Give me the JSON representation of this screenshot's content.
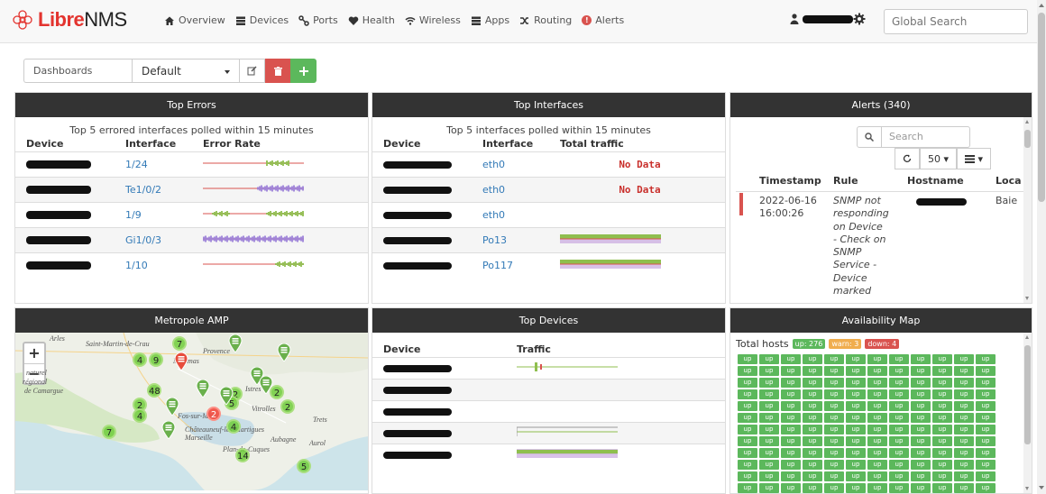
{
  "brand": {
    "part1": "Libre",
    "part2": "NMS"
  },
  "nav": {
    "items": [
      {
        "label": "Overview",
        "icon": "home-icon"
      },
      {
        "label": "Devices",
        "icon": "server-icon"
      },
      {
        "label": "Ports",
        "icon": "link-icon"
      },
      {
        "label": "Health",
        "icon": "heartbeat-icon"
      },
      {
        "label": "Wireless",
        "icon": "wifi-icon"
      },
      {
        "label": "Apps",
        "icon": "tasks-icon"
      },
      {
        "label": "Routing",
        "icon": "random-icon"
      },
      {
        "label": "Alerts",
        "icon": "exclamation-circle-icon"
      }
    ],
    "search_placeholder": "Global Search"
  },
  "dashboard": {
    "label": "Dashboards",
    "selected": "Default"
  },
  "top_errors": {
    "title": "Top Errors",
    "caption": "Top 5 errored interfaces polled within 15 minutes",
    "headers": [
      "Device",
      "Interface",
      "Error Rate"
    ],
    "rows": [
      {
        "interface": "1/24"
      },
      {
        "interface": "Te1/0/2"
      },
      {
        "interface": "1/9"
      },
      {
        "interface": "Gi1/0/3"
      },
      {
        "interface": "1/10"
      }
    ]
  },
  "top_interfaces": {
    "title": "Top Interfaces",
    "caption": "Top 5 interfaces polled within 15 minutes",
    "headers": [
      "Device",
      "Interface",
      "Total traffic"
    ],
    "rows": [
      {
        "interface": "eth0",
        "traffic": "No Data"
      },
      {
        "interface": "eth0",
        "traffic": "No Data"
      },
      {
        "interface": "eth0",
        "traffic": ""
      },
      {
        "interface": "Po13",
        "traffic": ""
      },
      {
        "interface": "Po117",
        "traffic": ""
      }
    ]
  },
  "alerts": {
    "title": "Alerts (340)",
    "search_placeholder": "Search",
    "page_size": "50",
    "headers": [
      "Timestamp",
      "Rule",
      "Hostname",
      "Loca"
    ],
    "row": {
      "timestamp_line1": "2022-06-16",
      "timestamp_line2": "16:00:26",
      "rule_lines": [
        "SNMP not",
        "responding",
        "on Device",
        "- Check on",
        "SNMP",
        "Service -",
        "Device",
        "marked"
      ],
      "location": "Baie"
    },
    "severity_color": "#d9534f"
  },
  "map_widget": {
    "title": "Metropole AMP",
    "zoom_in": "+",
    "zoom_out": "−",
    "labels": [
      "Arles",
      "Saint-Martin-de-Crau",
      "Provence",
      "Miramas",
      "naturel",
      "régional",
      "de Camargue",
      "Istres",
      "Fos-sur-Mer",
      "Châteauneuf-les-Martigues",
      "Marseille",
      "Plan-de-Cuques",
      "Aubagne",
      "Vitrolles",
      "Trets",
      "Aurol"
    ],
    "clusters": [
      "7",
      "4",
      "9",
      "48",
      "2",
      "4",
      "2",
      "5",
      "2",
      "2",
      "14",
      "5",
      "2",
      "4",
      "7"
    ]
  },
  "top_devices": {
    "title": "Top Devices",
    "headers": [
      "Device",
      "Traffic"
    ]
  },
  "availability": {
    "title": "Availability Map",
    "total_label": "Total hosts",
    "up": "up: 276",
    "warn": "warn: 3",
    "down": "down: 4",
    "cell_label": "up",
    "up_color": "#5cb85c",
    "warn_color": "#f0ad4e",
    "down_color": "#d9534f"
  }
}
